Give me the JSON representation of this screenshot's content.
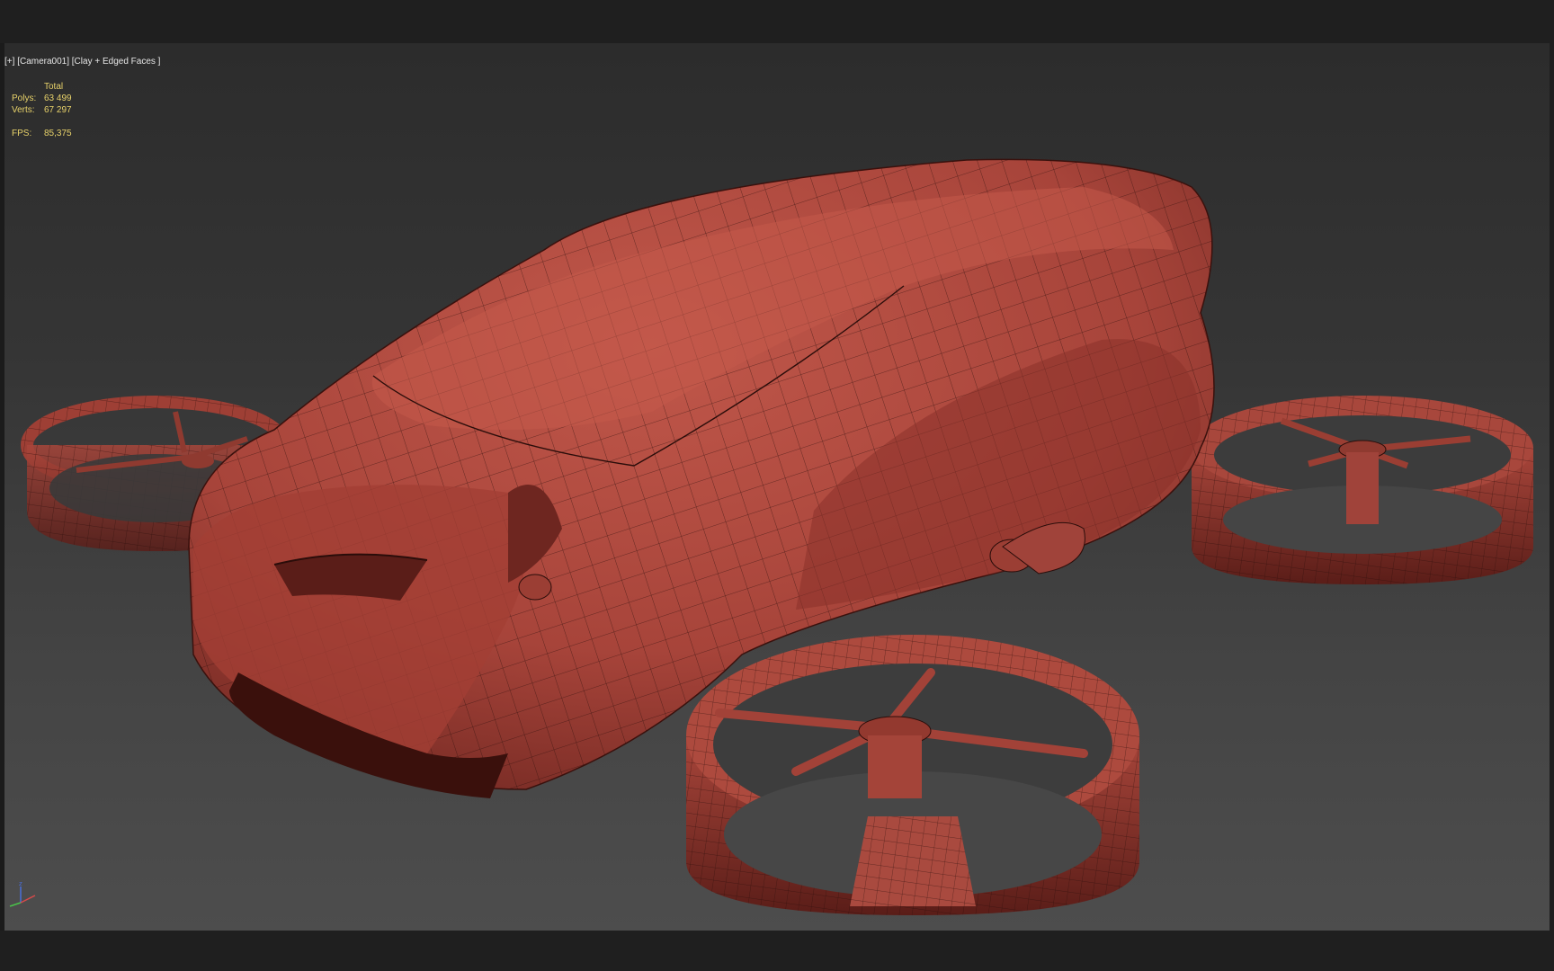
{
  "viewport": {
    "menu_plus": "[+]",
    "camera": "[Camera001]",
    "shading": "[Clay + Edged Faces ]"
  },
  "stats": {
    "header": "Total",
    "polys_label": "Polys:",
    "polys_value": "63 499",
    "verts_label": "Verts:",
    "verts_value": "67 297",
    "fps_label": "FPS:",
    "fps_value": "85,375"
  },
  "colors": {
    "clay": "#b34a3e",
    "clay_dark": "#6e2620",
    "wire": "#2a0d0a",
    "stats_text": "#e8d26a"
  },
  "icons": {
    "axis_gizmo": "xyz-axis-icon"
  }
}
